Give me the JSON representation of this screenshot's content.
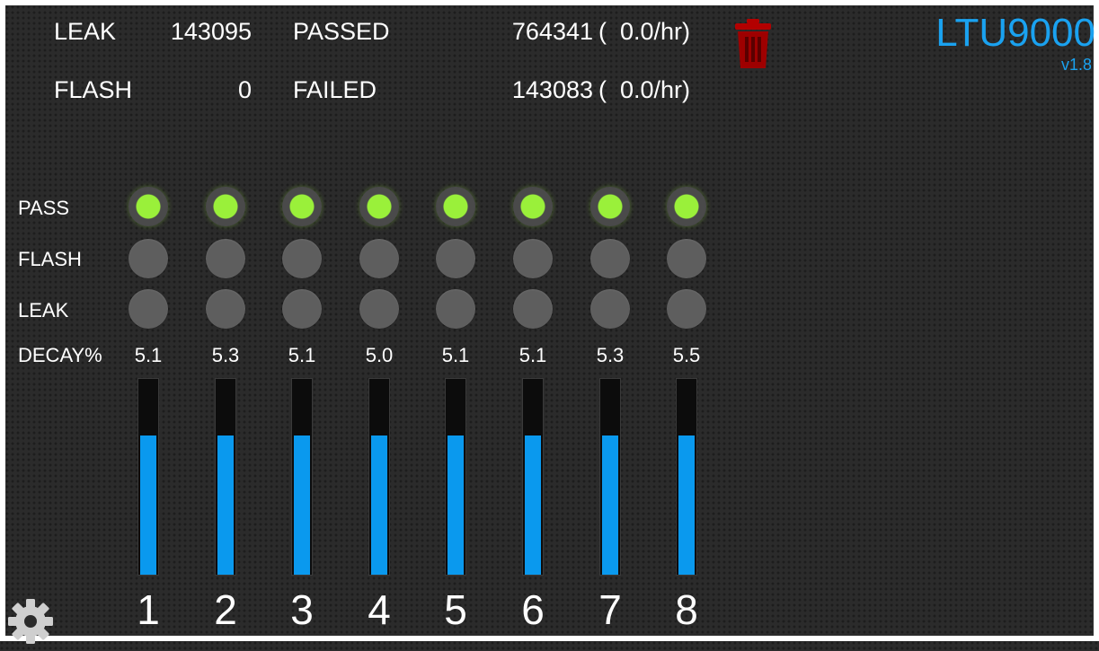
{
  "header": {
    "leak_label": "LEAK",
    "leak_count": "143095",
    "flash_label": "FLASH",
    "flash_count": "0",
    "passed_label": "PASSED",
    "passed_count": "764341",
    "passed_rate": "(  0.0/hr)",
    "failed_label": "FAILED",
    "failed_count": "143083",
    "failed_rate": "(  0.0/hr)"
  },
  "brand": {
    "title": "LTU9000",
    "version": "v1.8",
    "color": "#1aa2f0"
  },
  "rows": {
    "pass": "PASS",
    "flash": "FLASH",
    "leak": "LEAK",
    "decay": "DECAY%"
  },
  "colors": {
    "led_on": "#9af03a",
    "led_off": "#5e5e5e",
    "bar_fill": "#0a99ee",
    "trash": "#b30000"
  },
  "icons": {
    "trash": "trash-icon",
    "settings": "gear-icon"
  },
  "channels": [
    {
      "number": "1",
      "pass": true,
      "flash": false,
      "leak": false,
      "decay": "5.1",
      "level": 0.71
    },
    {
      "number": "2",
      "pass": true,
      "flash": false,
      "leak": false,
      "decay": "5.3",
      "level": 0.71
    },
    {
      "number": "3",
      "pass": true,
      "flash": false,
      "leak": false,
      "decay": "5.1",
      "level": 0.71
    },
    {
      "number": "4",
      "pass": true,
      "flash": false,
      "leak": false,
      "decay": "5.0",
      "level": 0.71
    },
    {
      "number": "5",
      "pass": true,
      "flash": false,
      "leak": false,
      "decay": "5.1",
      "level": 0.71
    },
    {
      "number": "6",
      "pass": true,
      "flash": false,
      "leak": false,
      "decay": "5.1",
      "level": 0.71
    },
    {
      "number": "7",
      "pass": true,
      "flash": false,
      "leak": false,
      "decay": "5.3",
      "level": 0.71
    },
    {
      "number": "8",
      "pass": true,
      "flash": false,
      "leak": false,
      "decay": "5.5",
      "level": 0.71
    }
  ]
}
